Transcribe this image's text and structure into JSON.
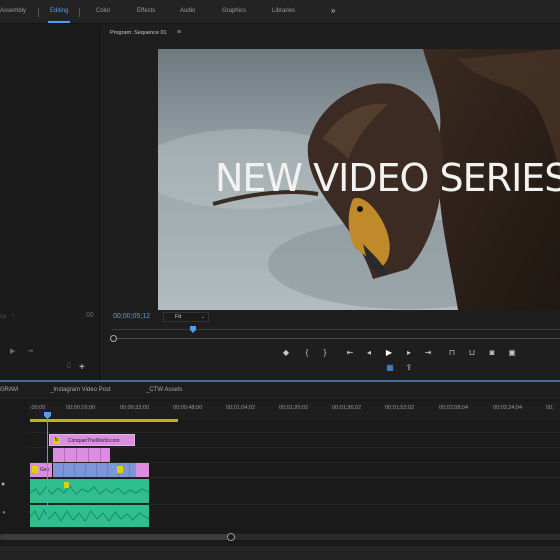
{
  "workspaces": {
    "items": [
      {
        "label": "Assembly"
      },
      {
        "label": "Editing"
      },
      {
        "label": "Color"
      },
      {
        "label": "Effects"
      },
      {
        "label": "Audio"
      },
      {
        "label": "Graphics"
      },
      {
        "label": "Libraries"
      }
    ],
    "active": "Editing",
    "overflow_icon": "double-chevron-right"
  },
  "program_monitor": {
    "title": "Program: Sequence 01",
    "menu_icon": "≡",
    "overlay_title": "NEW VIDEO SERIES",
    "timecode": "00;00;05;12",
    "zoom": "Fit"
  },
  "timeline": {
    "tabs": [
      {
        "label": "GRAM"
      },
      {
        "label": "_Instagram Video Post"
      },
      {
        "label": "_CTW Assets"
      }
    ],
    "ruler_ticks": [
      ":00;00",
      "00;00;16;00",
      "00;00;32;00",
      "00;00;48;00",
      "00;01;04;02",
      "00;01;20;02",
      "00;01;36;02",
      "00;01;52;02",
      "00;02;08;04",
      "00;02;24;04",
      "00;"
    ],
    "clips": {
      "title_clip": "ConquerTheWorld.com",
      "video_clip_label": "Gen"
    }
  },
  "colors": {
    "accent": "#4d9ff7",
    "graphic_clip": "#d98ee0",
    "video_clip": "#7d96d9",
    "audio_clip": "#2fbf8e",
    "work_area": "#c8b400"
  }
}
